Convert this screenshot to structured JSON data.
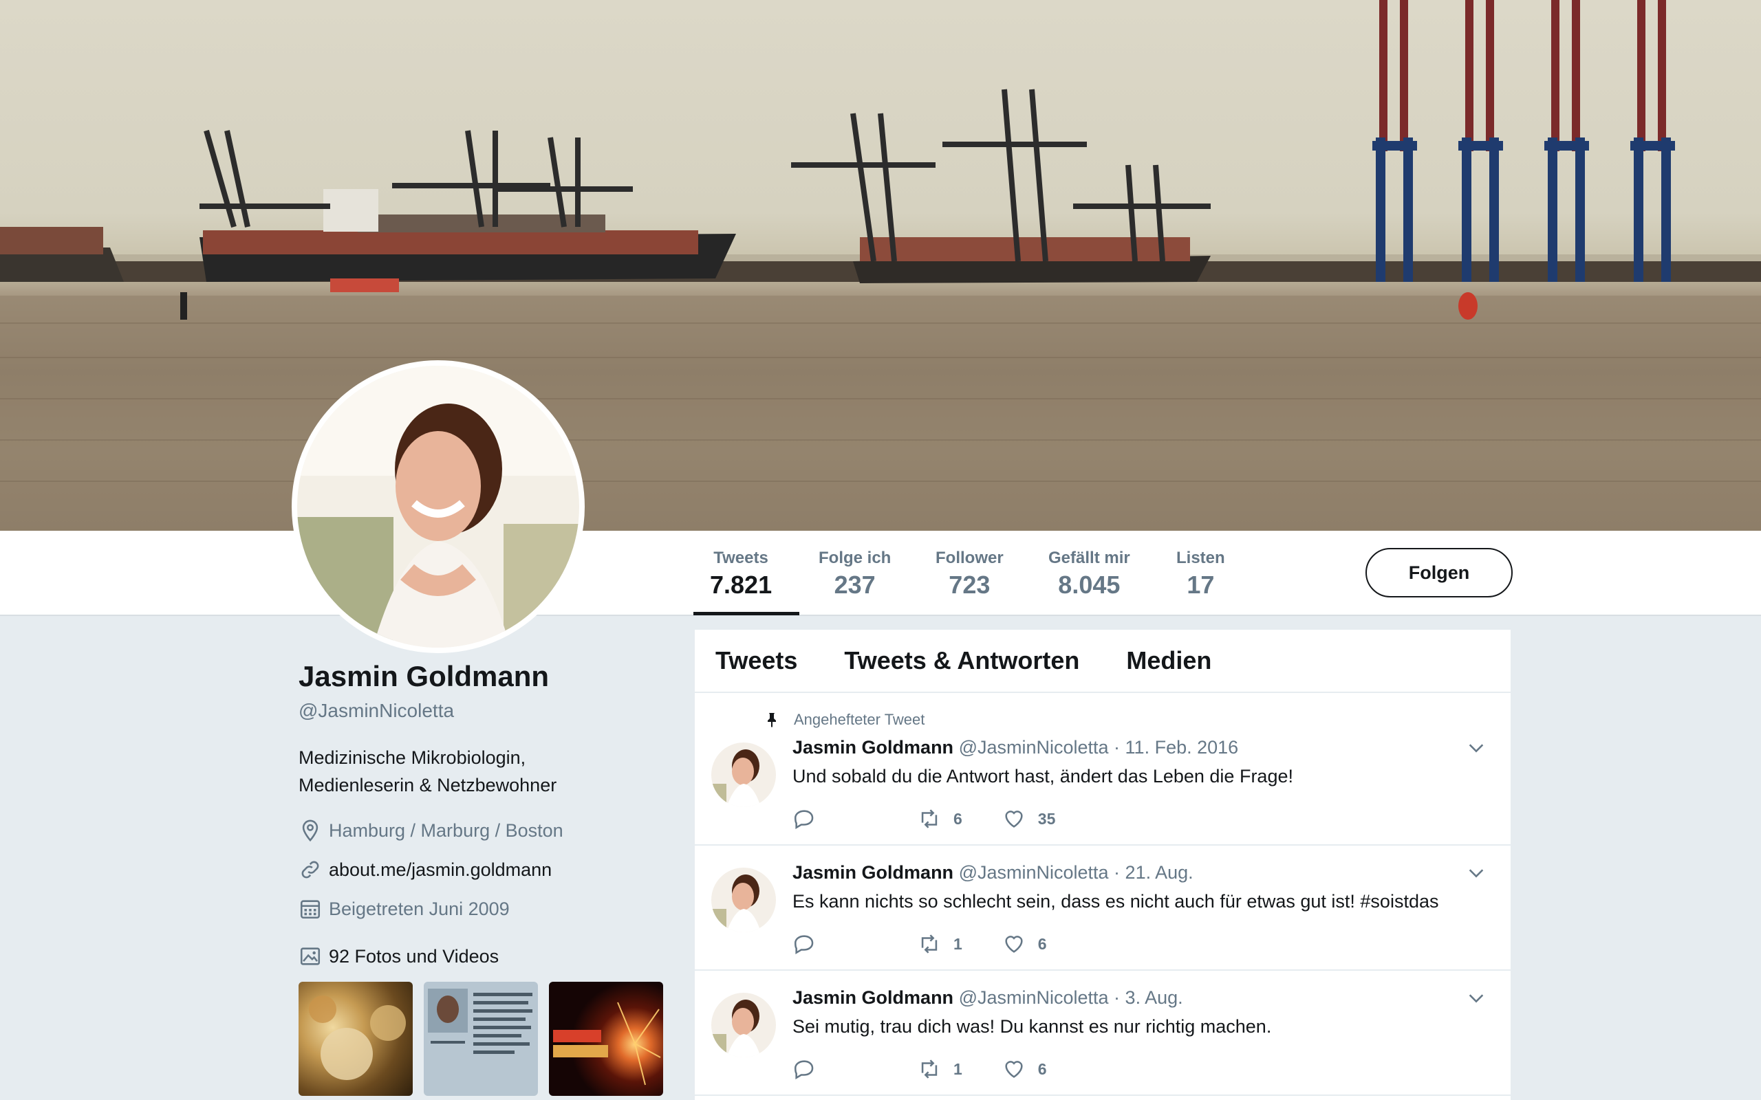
{
  "profile_nav": {
    "stats": [
      {
        "label": "Tweets",
        "value": "7.821",
        "active": true
      },
      {
        "label": "Folge ich",
        "value": "237"
      },
      {
        "label": "Follower",
        "value": "723"
      },
      {
        "label": "Gefällt mir",
        "value": "8.045"
      },
      {
        "label": "Listen",
        "value": "17"
      }
    ],
    "follow_label": "Folgen"
  },
  "profile": {
    "name": "Jasmin Goldmann",
    "handle": "@JasminNicoletta",
    "bio_line1": "Medizinische Mikrobiologin,",
    "bio_line2": "Medienleserin & Netzbewohner",
    "location": "Hamburg / Marburg / Boston",
    "website": "about.me/jasmin.goldmann",
    "joined": "Beigetreten Juni 2009",
    "photos_label": "92 Fotos und Videos"
  },
  "timeline": {
    "tabs": [
      "Tweets",
      "Tweets & Antworten",
      "Medien"
    ],
    "pinned_label": "Angehefteter Tweet",
    "tweets": [
      {
        "name": "Jasmin Goldmann",
        "meta": "@JasminNicoletta · 11. Feb. 2016",
        "text": "Und sobald du die Antwort hast, ändert das Leben die Frage!",
        "retweets": "6",
        "likes": "35"
      },
      {
        "name": "Jasmin Goldmann",
        "meta": "@JasminNicoletta · 21. Aug.",
        "text": "Es kann nichts so schlecht sein, dass es nicht auch für etwas gut ist! #soistdas",
        "retweets": "1",
        "likes": "6"
      },
      {
        "name": "Jasmin Goldmann",
        "meta": "@JasminNicoletta · 3. Aug.",
        "text": "Sei mutig, trau dich was! Du kannst es nur richtig machen.",
        "retweets": "1",
        "likes": "6"
      }
    ]
  },
  "icons": {
    "pin": "pin-icon",
    "location": "location-pin-icon",
    "link": "link-icon",
    "calendar": "calendar-icon",
    "photos": "image-icon",
    "reply": "reply-icon",
    "retweet": "retweet-icon",
    "like": "heart-icon",
    "caret": "chevron-down-icon"
  },
  "colors": {
    "text": "#14171a",
    "secondary": "#657786",
    "background": "#e6ecf0",
    "border": "#e6ecf0"
  }
}
